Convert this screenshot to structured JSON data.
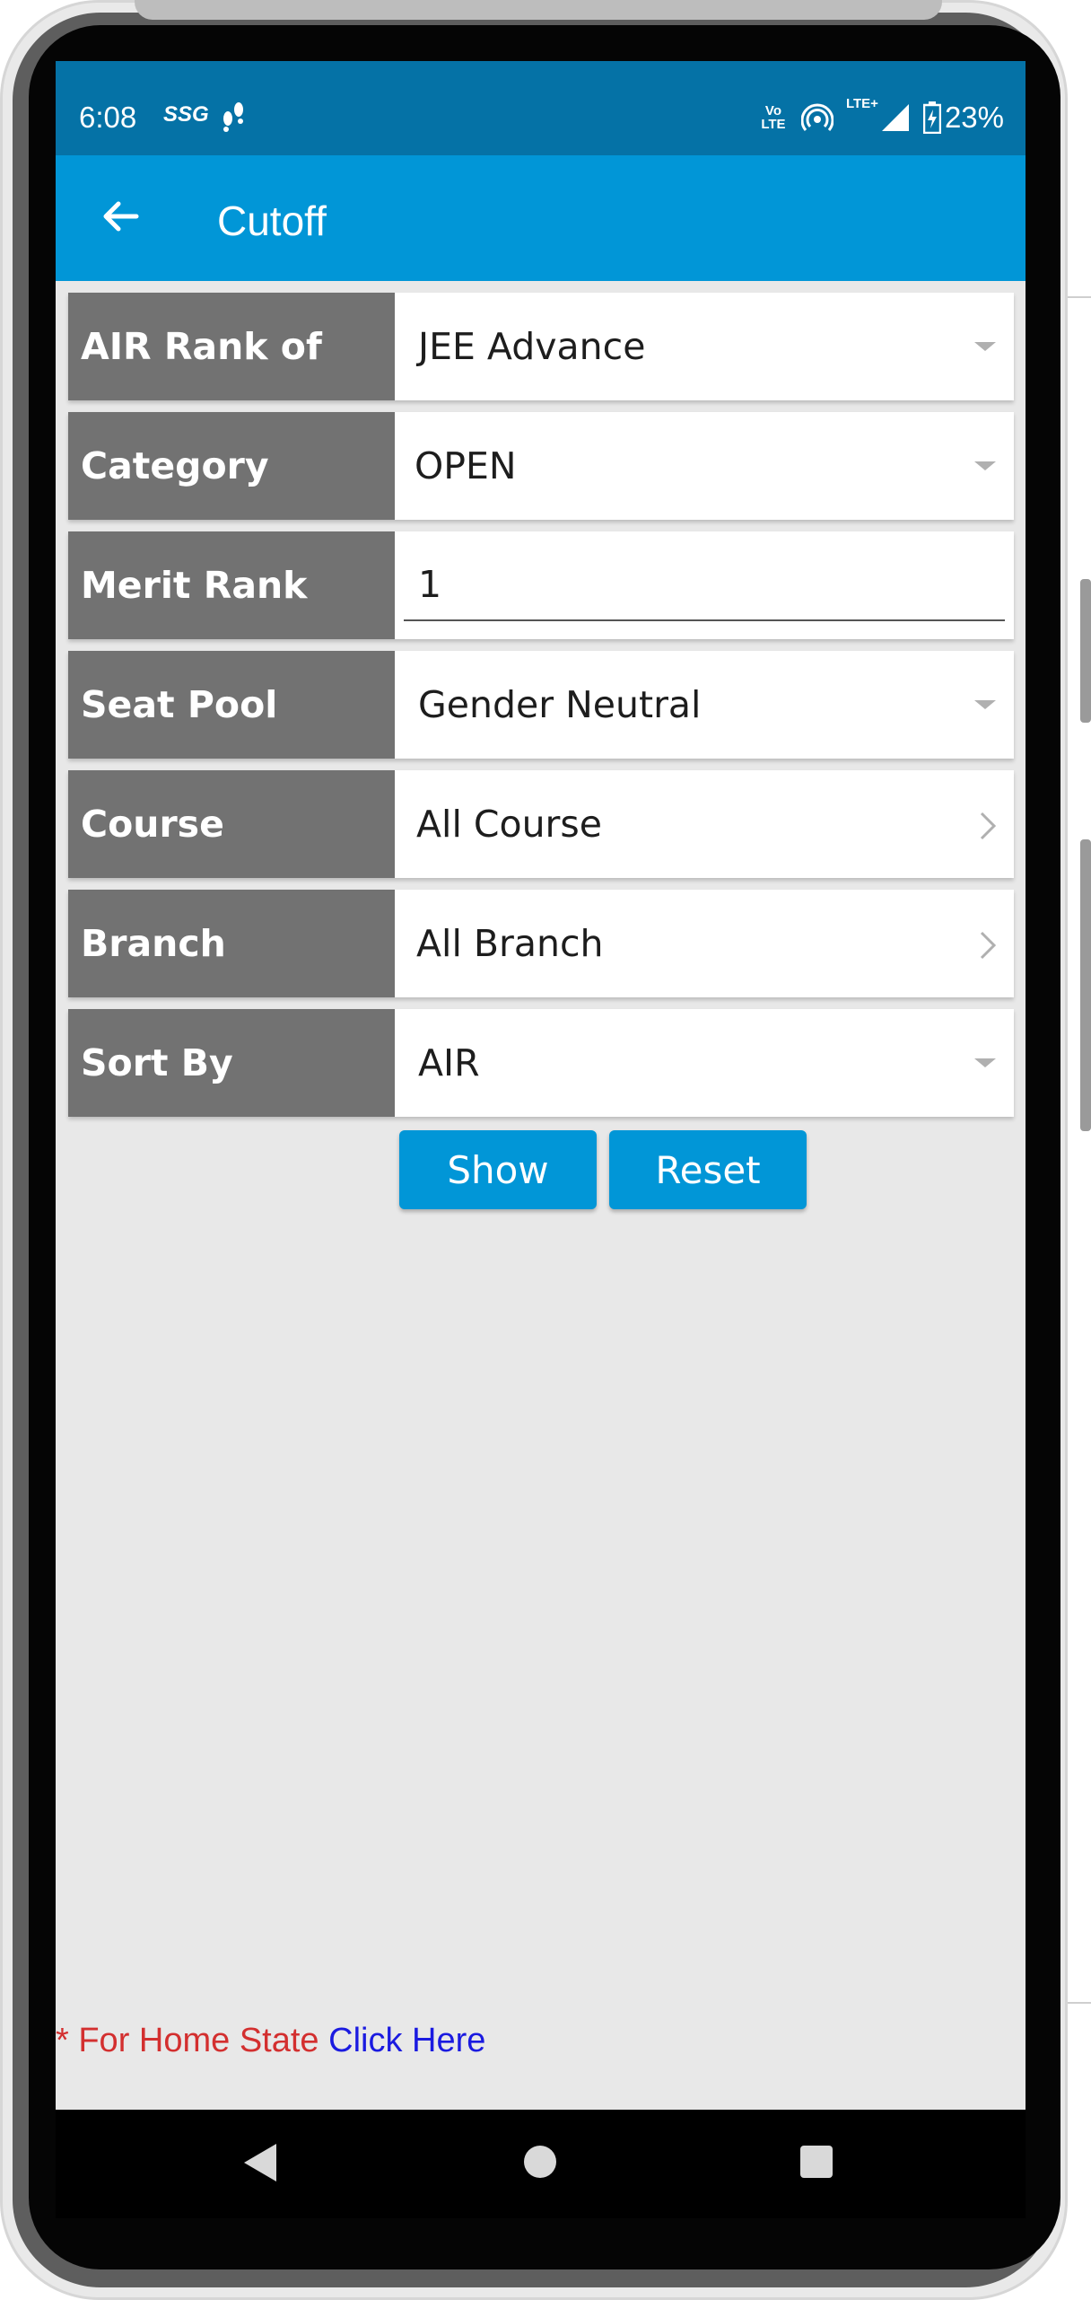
{
  "status_bar": {
    "time": "6:08",
    "glyph_1": "SSG",
    "glyph_2": "⁕",
    "volte": "Vo LTE",
    "lte": "LTE+",
    "battery": "23%"
  },
  "app_bar": {
    "title": "Cutoff",
    "back_icon": "arrow-left-icon"
  },
  "form": {
    "rows": [
      {
        "label": "AIR Rank of",
        "value": "JEE Advance",
        "control": "dropdown"
      },
      {
        "label": "Category",
        "value": "OPEN",
        "control": "dropdown"
      },
      {
        "label": "Merit Rank",
        "value": "1",
        "control": "text-input"
      },
      {
        "label": "Seat Pool",
        "value": "Gender Neutral",
        "control": "dropdown"
      },
      {
        "label": "Course",
        "value": "All Course",
        "control": "chevron"
      },
      {
        "label": "Branch",
        "value": "All Branch",
        "control": "chevron"
      },
      {
        "label": "Sort By",
        "value": "AIR",
        "control": "dropdown"
      }
    ]
  },
  "buttons": {
    "show": "Show",
    "reset": "Reset"
  },
  "footer": {
    "note": "* For Home State",
    "link": "Click Here"
  },
  "nav_bar": {
    "back": "triangle-back-icon",
    "home": "circle-home-icon",
    "recents": "square-recents-icon"
  },
  "colors": {
    "status_bar": "#0572a6",
    "app_bar": "#0196d7",
    "label_bg": "#727272",
    "button": "#0196d7",
    "note_red": "#d32f2f",
    "link_blue": "#1a1ae0"
  }
}
